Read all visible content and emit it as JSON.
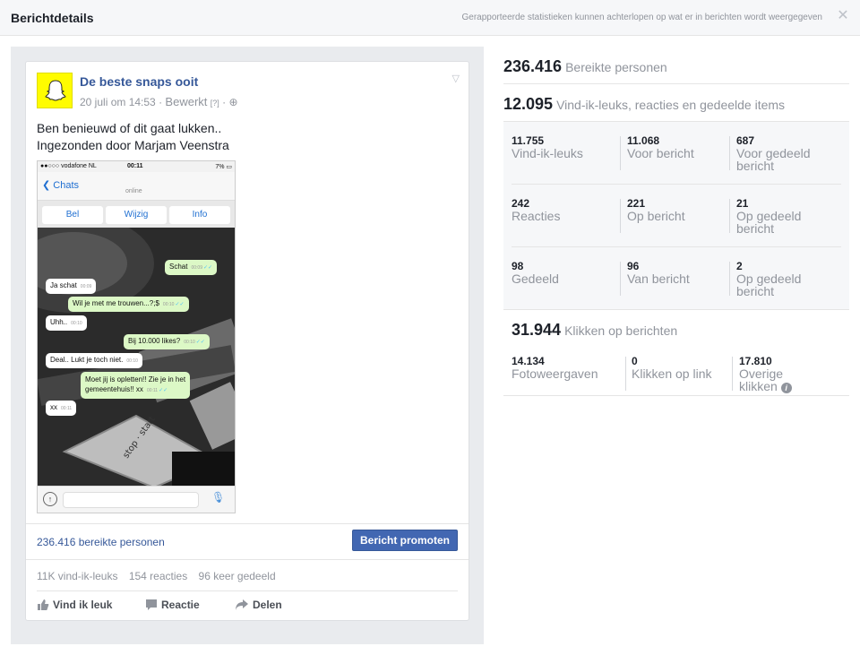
{
  "header": {
    "title": "Berichtdetails",
    "note": "Gerapporteerde statistieken kunnen achterlopen op wat er in berichten wordt weergegeven",
    "close_icon": "close-icon"
  },
  "post": {
    "page_name": "De beste snaps ooit",
    "date": "20 juli om 14:53",
    "edited": "Bewerkt",
    "help": "[?]",
    "text_line1": "Ben benieuwd of dit gaat lukken..",
    "text_line2": "Ingezonden door Marjam Veenstra",
    "reach_link": "236.416 bereikte personen",
    "promote_label": "Bericht promoten",
    "counts": {
      "likes": "11K vind-ik-leuks",
      "reactions": "154 reacties",
      "shares": "96 keer gedeeld"
    },
    "actions": {
      "like": "Vind ik leuk",
      "comment": "Reactie",
      "share": "Delen"
    },
    "image": {
      "carrier": "●●○○○ vodafone NL  ",
      "time": "00:11",
      "battery": "7% ▭",
      "back": "Chats",
      "online": "online",
      "buttons": [
        "Bel",
        "Wijzig",
        "Info"
      ],
      "messages": [
        {
          "text": "Schat",
          "time": "00:09",
          "dir": "out"
        },
        {
          "text": "Ja schat",
          "time": "00:09",
          "dir": "in"
        },
        {
          "text": "Wil je met me trouwen...?;$",
          "time": "00:10",
          "dir": "out"
        },
        {
          "text": "Uhh..",
          "time": "00:10",
          "dir": "in"
        },
        {
          "text": "Bij 10.000 likes?",
          "time": "00:10",
          "dir": "out"
        },
        {
          "text": "Deal.. Lukt je toch niet.",
          "time": "00:10",
          "dir": "in"
        },
        {
          "text": "Moet jij is opletten!! Zie je in het",
          "text2": "gemeentehuis!! xx",
          "time": "00:11",
          "dir": "out"
        },
        {
          "text": "xx",
          "time": "00:11",
          "dir": "in"
        }
      ],
      "key_label": "stop · start"
    }
  },
  "stats": {
    "reach": {
      "value": "236.416",
      "label": "Bereikte personen"
    },
    "engagement": {
      "value": "12.095",
      "label": "Vind-ik-leuks, reacties en gedeelde items"
    },
    "rows": [
      [
        {
          "value": "11.755",
          "label": "Vind-ik-leuks"
        },
        {
          "value": "11.068",
          "label": "Voor bericht"
        },
        {
          "value": "687",
          "label": "Voor gedeeld bericht"
        }
      ],
      [
        {
          "value": "242",
          "label": "Reacties"
        },
        {
          "value": "221",
          "label": "Op bericht"
        },
        {
          "value": "21",
          "label": "Op gedeeld bericht"
        }
      ],
      [
        {
          "value": "98",
          "label": "Gedeeld"
        },
        {
          "value": "96",
          "label": "Van bericht"
        },
        {
          "value": "2",
          "label": "Op gedeeld bericht"
        }
      ]
    ],
    "clicks": {
      "value": "31.944",
      "label": "Klikken op berichten"
    },
    "click_cells": [
      {
        "value": "14.134",
        "label": "Fotoweergaven"
      },
      {
        "value": "0",
        "label": "Klikken op link"
      },
      {
        "value": "17.810",
        "label": "Overige klikken"
      }
    ],
    "info_icon": "i"
  },
  "colors": {
    "link": "#365899",
    "button": "#4267b2",
    "muted": "#90949c",
    "snap_yellow": "#fffc00"
  }
}
